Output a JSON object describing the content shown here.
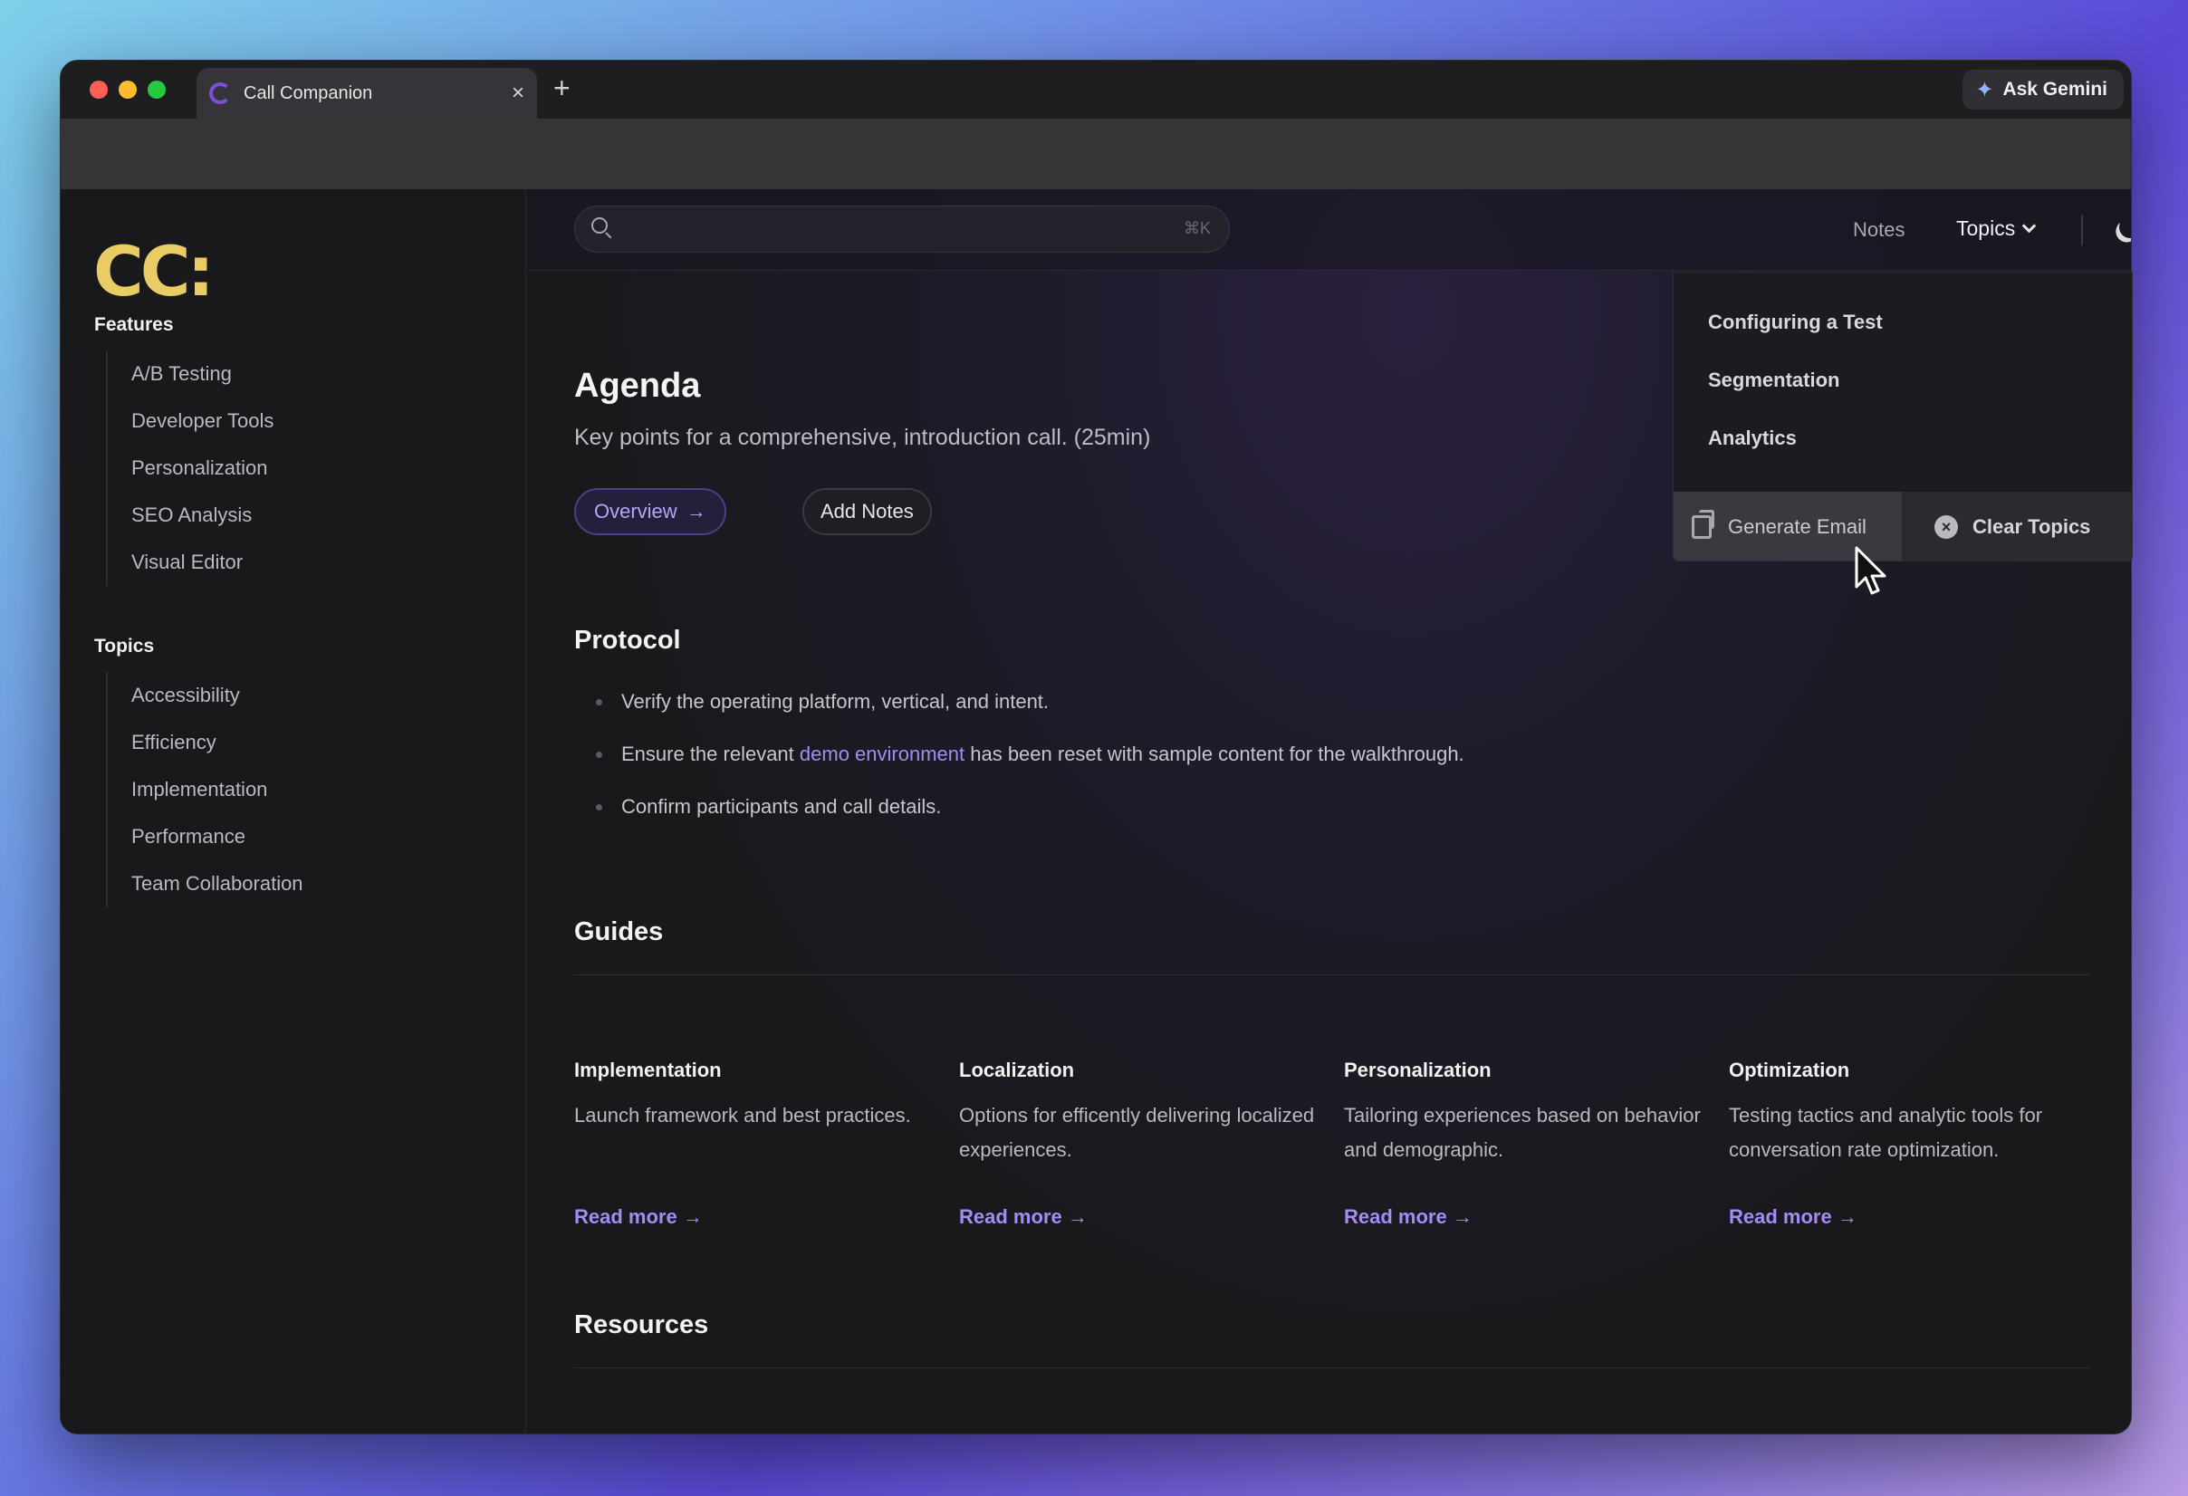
{
  "browser": {
    "tab_title": "Call Companion",
    "tab_close": "×",
    "new_tab": "+",
    "ask_gemini": "Ask Gemini"
  },
  "sidebar": {
    "logo": "CC:",
    "features_heading": "Features",
    "features": [
      "A/B Testing",
      "Developer Tools",
      "Personalization",
      "SEO Analysis",
      "Visual Editor"
    ],
    "topics_heading": "Topics",
    "topics": [
      "Accessibility",
      "Efficiency",
      "Implementation",
      "Performance",
      "Team Collaboration"
    ]
  },
  "topbar": {
    "search_shortcut": "⌘K",
    "notes": "Notes",
    "topics": "Topics"
  },
  "agenda": {
    "title": "Agenda",
    "subtitle": "Key points for a comprehensive, introduction call. (25min)",
    "overview_button": "Overview",
    "overview_arrow": "→",
    "add_notes_button": "Add Notes"
  },
  "protocol": {
    "heading": "Protocol",
    "item1": "Verify the operating platform, vertical, and intent.",
    "item2_before": "Ensure the relevant ",
    "item2_link": "demo environment",
    "item2_after": " has been reset with sample content for the walkthrough.",
    "item3": "Confirm participants and call details."
  },
  "guides": {
    "heading": "Guides",
    "items": [
      {
        "title": "Implementation",
        "desc": "Launch framework and best practices.",
        "link": "Read more →"
      },
      {
        "title": "Localization",
        "desc": "Options for efficently delivering localized experiences.",
        "link": "Read more →"
      },
      {
        "title": "Personalization",
        "desc": "Tailoring experiences based on behavior and demographic.",
        "link": "Read more →"
      },
      {
        "title": "Optimization",
        "desc": "Testing tactics and analytic tools for conversation rate optimization.",
        "link": "Read more →"
      }
    ]
  },
  "resources": {
    "heading": "Resources"
  },
  "dropdown": {
    "items": [
      "Configuring a Test",
      "Segmentation",
      "Analytics"
    ],
    "generate_email": "Generate Email",
    "clear_topics": "Clear Topics",
    "clear_icon": "×"
  },
  "colors": {
    "accent": "#a58bf5",
    "logo": "#e9cd64",
    "background": "#19191c"
  }
}
